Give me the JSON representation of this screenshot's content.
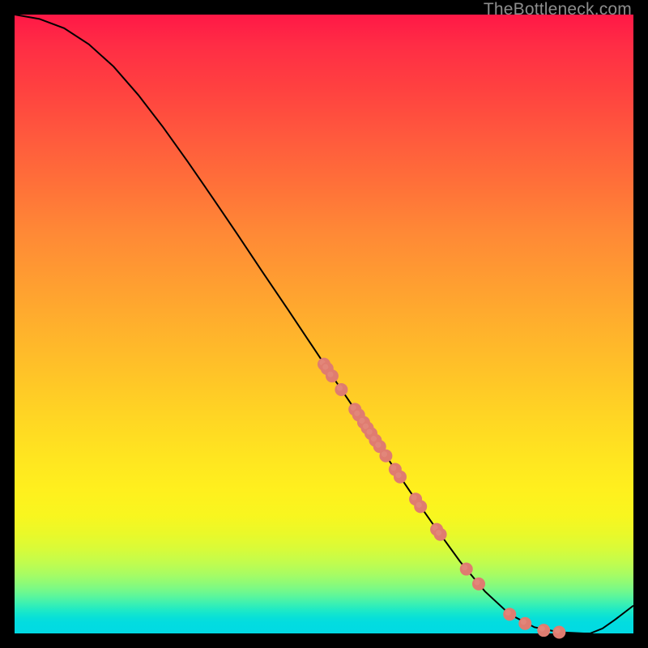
{
  "watermark": "TheBottleneck.com",
  "chart_data": {
    "type": "line",
    "title": "",
    "xlabel": "",
    "ylabel": "",
    "xlim": [
      0,
      100
    ],
    "ylim": [
      0,
      100
    ],
    "x": [
      0,
      4,
      8,
      12,
      16,
      20,
      24,
      28,
      32,
      36,
      40,
      44,
      48,
      52,
      56,
      60,
      64,
      68,
      72,
      76,
      80,
      84,
      88,
      92,
      93,
      95,
      97,
      100
    ],
    "y": [
      100,
      99.3,
      97.8,
      95.2,
      91.6,
      87.0,
      81.8,
      76.2,
      70.4,
      64.5,
      58.5,
      52.6,
      46.6,
      40.6,
      34.7,
      28.7,
      22.8,
      17.1,
      11.6,
      6.8,
      3.1,
      1.0,
      0.2,
      0.0,
      0.0,
      0.8,
      2.2,
      4.5
    ],
    "points": [
      {
        "x": 50.0,
        "y": 43.5
      },
      {
        "x": 50.5,
        "y": 42.8
      },
      {
        "x": 51.3,
        "y": 41.6
      },
      {
        "x": 52.8,
        "y": 39.4
      },
      {
        "x": 55.0,
        "y": 36.2
      },
      {
        "x": 55.6,
        "y": 35.3
      },
      {
        "x": 56.4,
        "y": 34.1
      },
      {
        "x": 57.0,
        "y": 33.2
      },
      {
        "x": 57.6,
        "y": 32.3
      },
      {
        "x": 58.3,
        "y": 31.2
      },
      {
        "x": 59.0,
        "y": 30.2
      },
      {
        "x": 60.0,
        "y": 28.7
      },
      {
        "x": 61.5,
        "y": 26.5
      },
      {
        "x": 62.3,
        "y": 25.3
      },
      {
        "x": 64.8,
        "y": 21.7
      },
      {
        "x": 65.6,
        "y": 20.5
      },
      {
        "x": 68.2,
        "y": 16.8
      },
      {
        "x": 68.8,
        "y": 16.0
      },
      {
        "x": 73.0,
        "y": 10.4
      },
      {
        "x": 75.0,
        "y": 8.0
      },
      {
        "x": 80.0,
        "y": 3.1
      },
      {
        "x": 82.5,
        "y": 1.6
      },
      {
        "x": 85.5,
        "y": 0.5
      },
      {
        "x": 88.0,
        "y": 0.2
      }
    ],
    "dot_color": "#df7c70",
    "dot_radius": 8
  }
}
